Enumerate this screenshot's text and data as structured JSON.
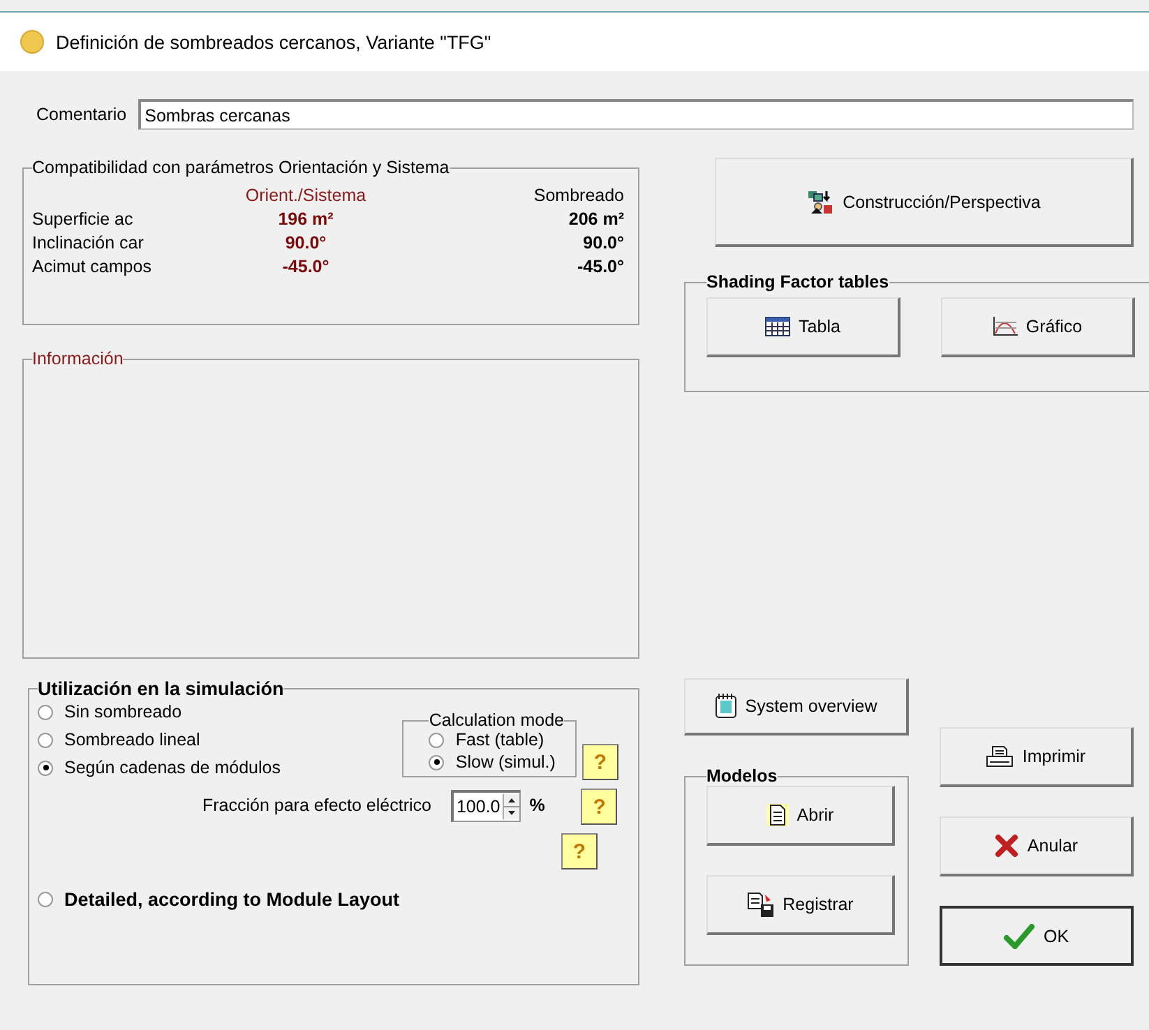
{
  "window": {
    "title": "Definición de sombreados cercanos, Variante \"TFG\""
  },
  "comment": {
    "label": "Comentario",
    "value": "Sombras cercanas"
  },
  "compatibility": {
    "title": "Compatibilidad con parámetros Orientación y Sistema",
    "columns": [
      "Orient./Sistema",
      "Sombreado"
    ],
    "rows": [
      {
        "label": "Superficie ac",
        "orient": "196 m²",
        "shading": "206 m²"
      },
      {
        "label": "Inclinación car",
        "orient": "90.0°",
        "shading": "90.0°"
      },
      {
        "label": "Acimut campos",
        "orient": "-45.0°",
        "shading": "-45.0°"
      }
    ]
  },
  "info": {
    "title": "Información"
  },
  "usage": {
    "title": "Utilización en la simulación",
    "options": [
      {
        "label": "Sin sombreado",
        "selected": false
      },
      {
        "label": "Sombreado lineal",
        "selected": false
      },
      {
        "label": "Según cadenas de módulos",
        "selected": true
      }
    ],
    "calculation_mode": {
      "title": "Calculation mode",
      "options": [
        {
          "label": "Fast (table)",
          "selected": false
        },
        {
          "label": "Slow (simul.)",
          "selected": true
        }
      ],
      "help": "?"
    },
    "fraction": {
      "label": "Fracción para efecto eléctrico",
      "value": "100.0",
      "unit": "%",
      "help": "?"
    },
    "extra_help": "?",
    "detailed": {
      "label": "Detailed, according to Module Layout",
      "selected": false
    }
  },
  "construction_button": "Construcción/Perspectiva",
  "shading_factor": {
    "title": "Shading Factor tables",
    "buttons": [
      "Tabla",
      "Gráfico"
    ]
  },
  "system_overview_button": "System overview",
  "models": {
    "title": "Modelos",
    "buttons": [
      "Abrir",
      "Registrar"
    ]
  },
  "actions": [
    "Imprimir",
    "Anular",
    "OK"
  ]
}
